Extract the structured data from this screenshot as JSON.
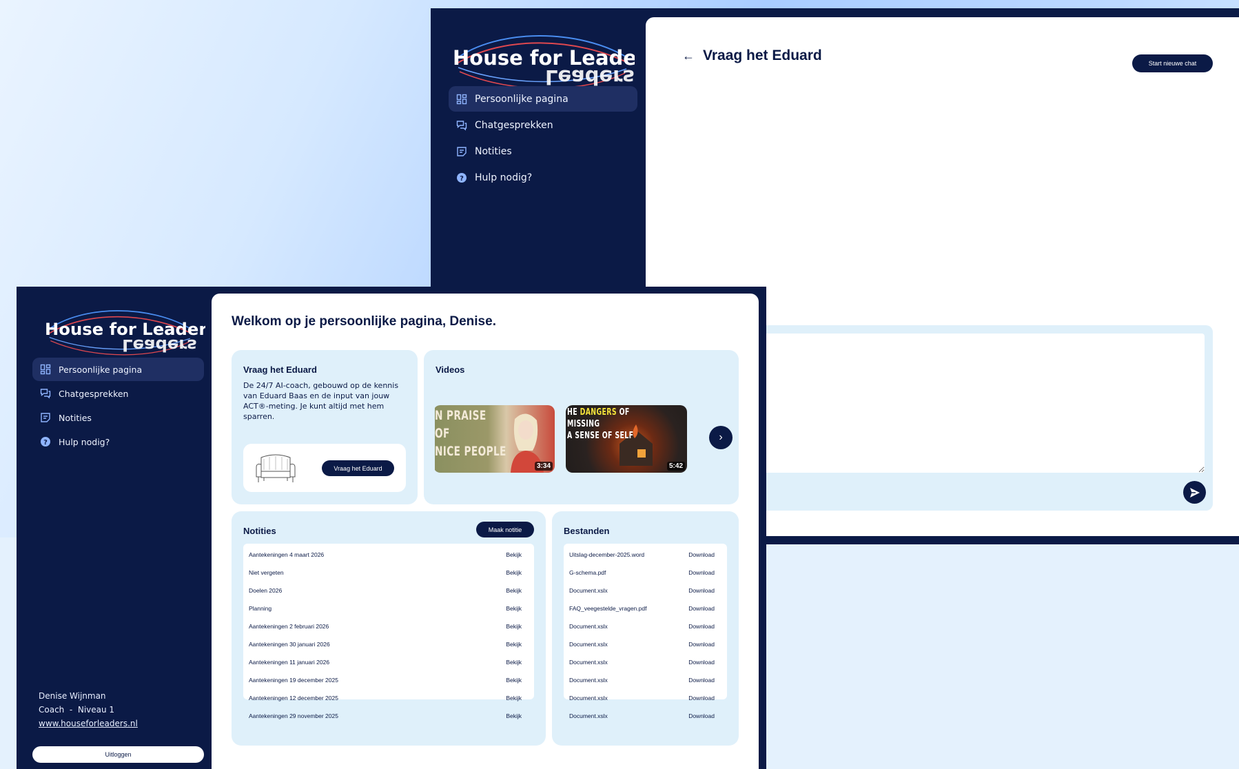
{
  "brand": {
    "logo_text": "House for Leaders",
    "logo_mirror": "Leaders"
  },
  "sidebar": {
    "items": [
      {
        "label": "Persoonlijke pagina",
        "icon": "dashboard-icon"
      },
      {
        "label": "Chatgesprekken",
        "icon": "chat-icon"
      },
      {
        "label": "Notities",
        "icon": "notes-icon"
      },
      {
        "label": "Hulp nodig?",
        "icon": "help-icon"
      }
    ],
    "user": {
      "name": "Denise Wijnman",
      "role_line": "Coach  -  Niveau 1",
      "website": "www.houseforleaders.nl"
    },
    "logout_label": "Uitloggen"
  },
  "chat": {
    "title": "Vraag het Eduard",
    "back_arrow": "←",
    "new_chat_label": "Start nieuwe chat",
    "input_value": ""
  },
  "home": {
    "welcome": "Welkom op je persoonlijke pagina, Denise.",
    "vraag": {
      "title": "Vraag het Eduard",
      "description": "De 24/7 AI-coach, gebouwd op de kennis van Eduard Baas en de input van jouw ACT®-meting. Je kunt altijd met hem sparren.",
      "button": "Vraag het Eduard"
    },
    "videos": {
      "title": "Videos",
      "items": [
        {
          "line1": "N PRAISE",
          "line2": "OF",
          "line3": "NICE PEOPLE",
          "duration": "3:34"
        },
        {
          "line1_a": "HE ",
          "line1_b": "DANGERS",
          "line1_c": " OF MISSING",
          "line2": "A SENSE OF SELF",
          "duration": "5:42"
        }
      ],
      "next": "›"
    },
    "notities": {
      "title": "Notities",
      "button": "Maak notitie",
      "rows": [
        {
          "name": "Aantekeningen 4 maart 2026",
          "action": "Bekijk"
        },
        {
          "name": "Niet vergeten",
          "action": "Bekijk"
        },
        {
          "name": "Doelen 2026",
          "action": "Bekijk"
        },
        {
          "name": "Planning",
          "action": "Bekijk"
        },
        {
          "name": "Aantekeningen 2 februari 2026",
          "action": "Bekijk"
        },
        {
          "name": "Aantekeningen 30 januari 2026",
          "action": "Bekijk"
        },
        {
          "name": "Aantekeningen 11 januari 2026",
          "action": "Bekijk"
        },
        {
          "name": "Aantekeningen 19 december 2025",
          "action": "Bekijk"
        },
        {
          "name": "Aantekeningen 12 december 2025",
          "action": "Bekijk"
        },
        {
          "name": "Aantekeningen 29 november 2025",
          "action": "Bekijk"
        }
      ]
    },
    "bestanden": {
      "title": "Bestanden",
      "rows": [
        {
          "name": "Uitslag-december-2025.word",
          "action": "Download"
        },
        {
          "name": "G-schema.pdf",
          "action": "Download"
        },
        {
          "name": "Document.xslx",
          "action": "Download"
        },
        {
          "name": "FAQ_veegestelde_vragen.pdf",
          "action": "Download"
        },
        {
          "name": "Document.xslx",
          "action": "Download"
        },
        {
          "name": "Document.xslx",
          "action": "Download"
        },
        {
          "name": "Document.xslx",
          "action": "Download"
        },
        {
          "name": "Document.xslx",
          "action": "Download"
        },
        {
          "name": "Document.xslx",
          "action": "Download"
        },
        {
          "name": "Document.xslx",
          "action": "Download"
        }
      ]
    }
  },
  "colors": {
    "navy": "#0b1a46",
    "light_blue": "#dff0fa",
    "active_nav": "#1f2f63",
    "logo_red": "#e0484f",
    "logo_blue": "#4a8df0"
  }
}
